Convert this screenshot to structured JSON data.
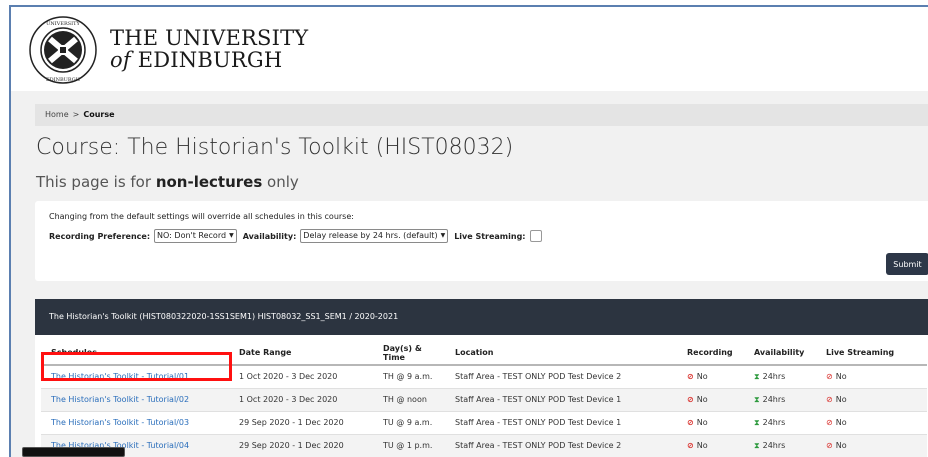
{
  "header": {
    "university_line1": "THE UNIVERSITY",
    "university_of": "of",
    "university_line2": "EDINBURGH",
    "crest_text": "THE UNIVERSITY OF EDINBURGH"
  },
  "breadcrumb": {
    "home": "Home",
    "separator": ">",
    "current": "Course"
  },
  "page": {
    "title": "Course: The Historian's Toolkit (HIST08032)",
    "subtitle_prefix": "This page is for",
    "subtitle_bold": "non-lectures",
    "subtitle_suffix": "only"
  },
  "settings": {
    "note": "Changing from the default settings will override all schedules in this course:",
    "recording_label": "Recording Preference:",
    "recording_value": "NO: Don't Record",
    "availability_label": "Availability:",
    "availability_value": "Delay release by 24 hrs. (default)",
    "live_label": "Live Streaming:",
    "submit_label": "Submit"
  },
  "table": {
    "header": "The Historian's Toolkit (HIST080322020-1SS1SEM1) HIST08032_SS1_SEM1 / 2020-2021",
    "columns": [
      "Schedules",
      "Date Range",
      "Day(s) & Time",
      "Location",
      "Recording",
      "Availability",
      "Live Streaming"
    ],
    "rows": [
      {
        "schedule": "The Historian's Toolkit - Tutorial/01",
        "dates": "1 Oct 2020 - 3 Dec 2020",
        "time": "TH @ 9 a.m.",
        "location": "Staff Area - TEST ONLY POD Test Device 2",
        "recording": "No",
        "availability": "24hrs",
        "live": "No"
      },
      {
        "schedule": "The Historian's Toolkit - Tutorial/02",
        "dates": "1 Oct 2020 - 3 Dec 2020",
        "time": "TH @ noon",
        "location": "Staff Area - TEST ONLY POD Test Device 1",
        "recording": "No",
        "availability": "24hrs",
        "live": "No"
      },
      {
        "schedule": "The Historian's Toolkit - Tutorial/03",
        "dates": "29 Sep 2020 - 1 Dec 2020",
        "time": "TU @ 9 a.m.",
        "location": "Staff Area - TEST ONLY POD Test Device 1",
        "recording": "No",
        "availability": "24hrs",
        "live": "No"
      },
      {
        "schedule": "The Historian's Toolkit - Tutorial/04",
        "dates": "29 Sep 2020 - 1 Dec 2020",
        "time": "TU @ 1 p.m.",
        "location": "Staff Area - TEST ONLY POD Test Device 2",
        "recording": "No",
        "availability": "24hrs",
        "live": "No"
      }
    ]
  },
  "colors": {
    "accent_link": "#2a6ebb",
    "header_bar": "#2c3440",
    "highlight": "#ff1010",
    "status_red": "#d9302c",
    "status_green": "#2d9a3e"
  },
  "icons": {
    "recording": "no-entry-icon",
    "availability": "hourglass-icon",
    "live": "no-broadcast-icon"
  }
}
